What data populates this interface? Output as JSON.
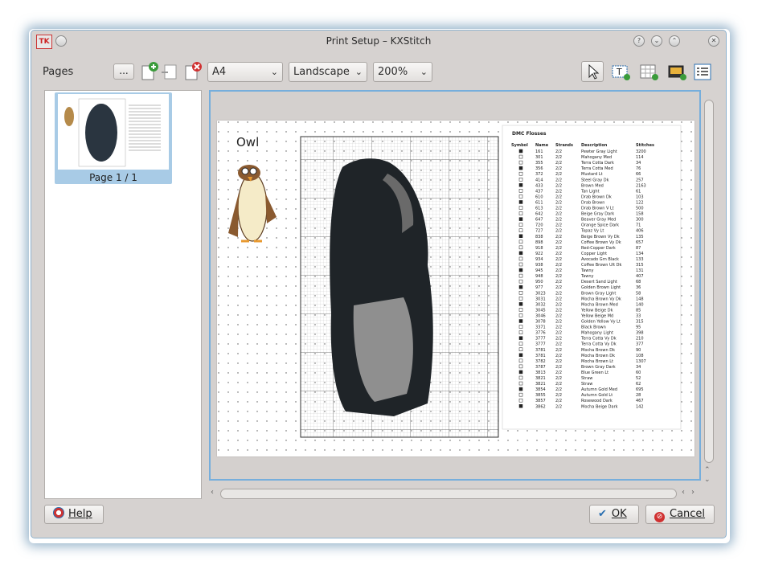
{
  "window": {
    "title": "Print Setup – KXStitch",
    "app_icon_text": "TK"
  },
  "toolbar": {
    "pages_label": "Pages",
    "more_button": "...",
    "paper_size": "A4",
    "orientation": "Landscape",
    "zoom": "200%"
  },
  "pages_list": [
    {
      "label": "Page 1 / 1",
      "selected": true
    }
  ],
  "preview": {
    "pattern_title": "Owl",
    "key_title": "DMC Flosses",
    "key_headers": [
      "Symbol",
      "Name",
      "Strands",
      "Description",
      "Stitches"
    ],
    "key_rows": [
      [
        "161",
        "2/2",
        "Pewter Gray Light",
        "3200"
      ],
      [
        "301",
        "2/2",
        "Mahogany Med",
        "114"
      ],
      [
        "355",
        "2/2",
        "Terra Cotta Dark",
        "34"
      ],
      [
        "356",
        "2/2",
        "Terra Cotta Med",
        "76"
      ],
      [
        "372",
        "2/2",
        "Mustard Lt",
        "66"
      ],
      [
        "414",
        "2/2",
        "Steel Gray Dk",
        "257"
      ],
      [
        "433",
        "2/2",
        "Brown Med",
        "2163"
      ],
      [
        "437",
        "2/2",
        "Tan Light",
        "61"
      ],
      [
        "610",
        "2/2",
        "Drab Brown Dk",
        "103"
      ],
      [
        "611",
        "2/2",
        "Drab Brown",
        "122"
      ],
      [
        "613",
        "2/2",
        "Drab Brown V Lt",
        "500"
      ],
      [
        "642",
        "2/2",
        "Beige Gray Dark",
        "158"
      ],
      [
        "647",
        "2/2",
        "Beaver Gray Med",
        "300"
      ],
      [
        "720",
        "2/2",
        "Orange Spice Dark",
        "71"
      ],
      [
        "727",
        "2/2",
        "Topaz Vy Lt",
        "406"
      ],
      [
        "838",
        "2/2",
        "Beige Brown Vy Dk",
        "135"
      ],
      [
        "898",
        "2/2",
        "Coffee Brown Vy Dk",
        "657"
      ],
      [
        "918",
        "2/2",
        "Red-Copper Dark",
        "87"
      ],
      [
        "922",
        "2/2",
        "Copper Light",
        "134"
      ],
      [
        "934",
        "2/2",
        "Avocado Grn Black",
        "133"
      ],
      [
        "938",
        "2/2",
        "Coffee Brown Ult Dk",
        "315"
      ],
      [
        "945",
        "2/2",
        "Tawny",
        "131"
      ],
      [
        "948",
        "2/2",
        "Tawny",
        "407"
      ],
      [
        "950",
        "2/2",
        "Desert Sand Light",
        "68"
      ],
      [
        "977",
        "2/2",
        "Golden Brown Light",
        "36"
      ],
      [
        "3023",
        "2/2",
        "Brown Gray Light",
        "58"
      ],
      [
        "3031",
        "2/2",
        "Mocha Brown Vy Dk",
        "148"
      ],
      [
        "3032",
        "2/2",
        "Mocha Brown Med",
        "140"
      ],
      [
        "3045",
        "2/2",
        "Yellow Beige Dk",
        "85"
      ],
      [
        "3046",
        "2/2",
        "Yellow Beige Md",
        "33"
      ],
      [
        "3078",
        "2/2",
        "Golden Yellow Vy Lt",
        "315"
      ],
      [
        "3371",
        "2/2",
        "Black Brown",
        "95"
      ],
      [
        "3776",
        "2/2",
        "Mahogany Light",
        "398"
      ],
      [
        "3777",
        "2/2",
        "Terra Cotta Vy Dk",
        "210"
      ],
      [
        "3777",
        "2/2",
        "Terra Cotta Vy Dk",
        "377"
      ],
      [
        "3781",
        "2/2",
        "Mocha Brown Dk",
        "90"
      ],
      [
        "3781",
        "2/2",
        "Mocha Brown Dk",
        "108"
      ],
      [
        "3782",
        "2/2",
        "Mocha Brown Lt",
        "1307"
      ],
      [
        "3787",
        "2/2",
        "Brown Gray Dark",
        "34"
      ],
      [
        "3813",
        "2/2",
        "Blue Green Lt",
        "60"
      ],
      [
        "3821",
        "2/2",
        "Straw",
        "52"
      ],
      [
        "3821",
        "2/2",
        "Straw",
        "62"
      ],
      [
        "3854",
        "2/2",
        "Autumn Gold Med",
        "695"
      ],
      [
        "3855",
        "2/2",
        "Autumn Gold Lt",
        "28"
      ],
      [
        "3857",
        "2/2",
        "Rosewood Dark",
        "467"
      ],
      [
        "3862",
        "2/2",
        "Mocha Beige Dark",
        "142"
      ]
    ]
  },
  "footer": {
    "help": "Help",
    "ok": "OK",
    "cancel": "Cancel"
  },
  "colors": {
    "selection": "#a8cbe6",
    "focus_border": "#76aedc",
    "window_bg": "#d6d2d0"
  }
}
